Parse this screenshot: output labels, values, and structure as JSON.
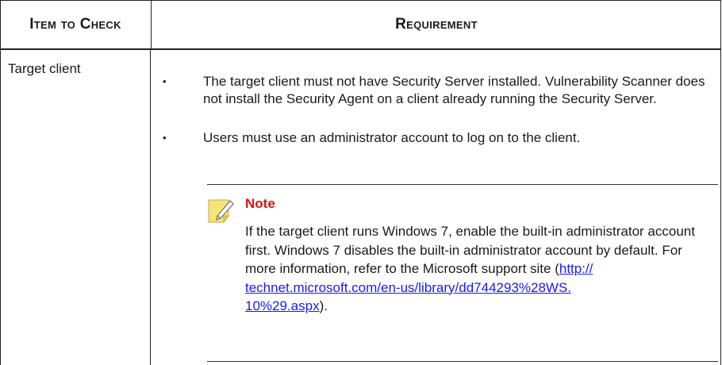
{
  "table": {
    "headers": {
      "item": "Item to Check",
      "requirement": "Requirement"
    },
    "rows": [
      {
        "item": "Target client",
        "bullets": [
          "The target client must not have Security Server installed. Vulnerability Scanner does not install the Security Agent on a client already running the Security Server.",
          "Users must use an administrator account to log on to the client."
        ],
        "note": {
          "title": "Note",
          "text_before_link": "If the target client runs Windows 7, enable the built-in administrator account first. Windows 7 disables the built-in administrator account by default. For more information, refer to the Microsoft support site (",
          "link_line1": "http://",
          "link_line2": "technet.microsoft.com/en-us/library/dd744293%28WS.",
          "link_line3": "10%29.aspx",
          "text_after_link": ").",
          "icon": "note-pencil-icon"
        }
      }
    ]
  },
  "colors": {
    "note_title": "#d21414",
    "link": "#1a1aee",
    "note_icon_fill": "#f6e47a"
  }
}
